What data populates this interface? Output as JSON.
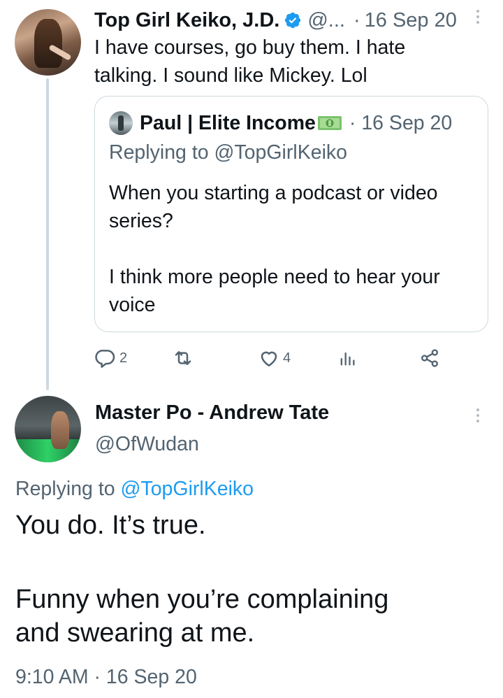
{
  "colors": {
    "text_primary": "#0f1419",
    "text_secondary": "#536471",
    "link_blue": "#1d9bf0",
    "verified_blue": "#1d9bf0",
    "border": "#cfd9de"
  },
  "tweet1": {
    "avatar_icon": "avatar",
    "author_name": "Top Girl Keiko, J.D.",
    "verified_icon": "verified-badge-icon",
    "handle": "@...",
    "separator": "·",
    "date": "16 Sep 20",
    "text_lines": [
      "I have courses, go buy them. I hate",
      "talking. I sound like Mickey. Lol"
    ],
    "quote": {
      "author_name": "Paul | Elite Income",
      "emoji_icon": "money-bill-icon",
      "separator": "·",
      "date": "16 Sep 20",
      "replying": "Replying to @TopGirlKeiko",
      "body_lines": [
        "When you starting a podcast or video",
        "series?",
        "",
        "I think more people need to hear your",
        "voice"
      ]
    },
    "actions": {
      "reply_icon": "reply-icon",
      "reply_count": "2",
      "retweet_icon": "retweet-icon",
      "like_icon": "heart-icon",
      "like_count": "4",
      "analytics_icon": "analytics-icon",
      "share_icon": "share-icon"
    }
  },
  "tweet2": {
    "avatar_icon": "avatar",
    "author_name": "Master Po - Andrew Tate",
    "handle": "@OfWudan",
    "replying_prefix": "Replying to ",
    "replying_mention": "@TopGirlKeiko",
    "body_lines": [
      "You do. It’s true.",
      "",
      "Funny when you’re complaining",
      "and swearing at me."
    ],
    "time": "9:10 AM",
    "separator": "·",
    "date": "16 Sep 20"
  }
}
